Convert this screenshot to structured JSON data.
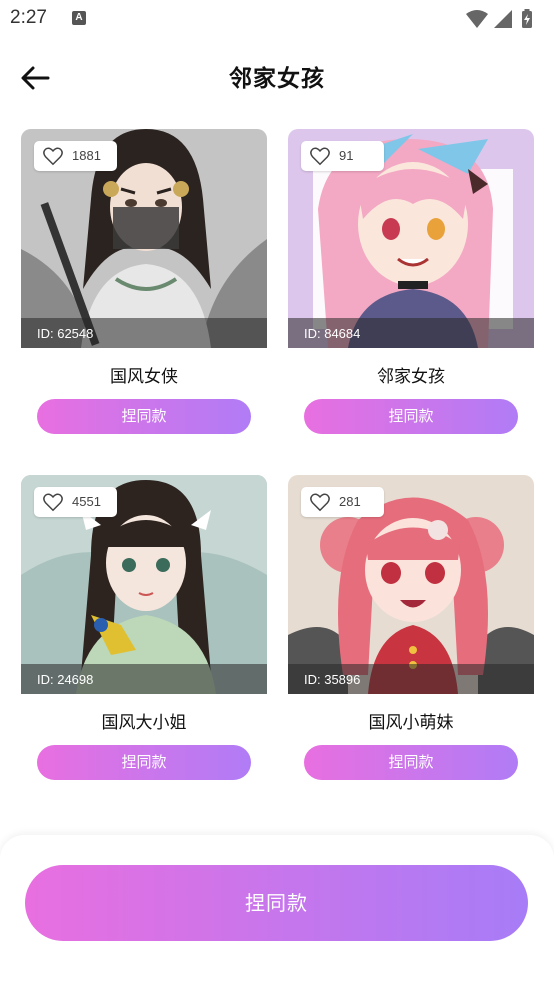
{
  "status_bar": {
    "time": "2:27",
    "notification_icon": "a-icon"
  },
  "header": {
    "back_icon": "arrow-left-icon",
    "title": "邻家女孩"
  },
  "accent_gradient": [
    "#e86fe0",
    "#b07cf6"
  ],
  "cards": [
    {
      "likes": "1881",
      "id_label": "ID: 62548",
      "name": "国风女侠",
      "button_label": "捏同款",
      "image": "avatar-ancient-swordswoman"
    },
    {
      "likes": "91",
      "id_label": "ID: 84684",
      "name": "邻家女孩",
      "button_label": "捏同款",
      "image": "avatar-pink-hair-sailor-girl"
    },
    {
      "likes": "4551",
      "id_label": "ID: 24698",
      "name": "国风大小姐",
      "button_label": "捏同款",
      "image": "avatar-ancient-lady-with-bird"
    },
    {
      "likes": "281",
      "id_label": "ID: 35896",
      "name": "国风小萌妹",
      "button_label": "捏同款",
      "image": "avatar-red-hair-qipao-girl"
    }
  ],
  "bottom": {
    "main_button_label": "捏同款"
  }
}
